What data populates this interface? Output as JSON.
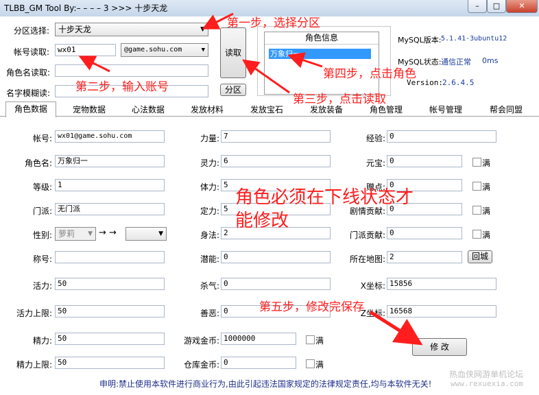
{
  "window": {
    "title": "TLBB_GM Tool By:– – – – 3 >>> 十步天龙",
    "controls": {
      "minimize": "–",
      "maximize": "□",
      "close": "✕"
    }
  },
  "top": {
    "region_label": "分区选择:",
    "region_value": "十步天龙",
    "account_label": "帐号读取:",
    "account_value": "wx01",
    "domain_value": "@game.sohu.com",
    "rolename_label": "角色名读取:",
    "fuzzy_label": "名字模糊读:",
    "read_button": "读取",
    "zone_button": "分区",
    "role_info_title": "角色信息",
    "role_list": [
      "万象归一"
    ],
    "mysql_version_label": "MySQL版本:",
    "mysql_version": "5.1.41-3ubuntu12",
    "mysql_status_label": "MySQL状态:",
    "mysql_status": "通信正常",
    "mysql_latency": "0ms",
    "version_label": "Version:",
    "version": "2.6.4.5"
  },
  "tabs": [
    "角色数据",
    "宠物数据",
    "心法数据",
    "发放材料",
    "发放宝石",
    "发放装备",
    "角色管理",
    "帐号管理",
    "帮会同盟"
  ],
  "fields": {
    "account_label": "帐号:",
    "account": "wx01@game.sohu.com",
    "rolename_label": "角色名:",
    "rolename": "万象归一",
    "level_label": "等级:",
    "level": "1",
    "sect_label": "门派:",
    "sect": "无门派",
    "gender_label": "性别:",
    "gender": "萝莉",
    "arrow_text": "→ →",
    "title_label": "称号:",
    "title": "",
    "vitality_label": "活力:",
    "vitality": "50",
    "vitality_max_label": "活力上限:",
    "vitality_max": "50",
    "energy_label": "精力:",
    "energy": "50",
    "energy_max_label": "精力上限:",
    "energy_max": "50",
    "strength_label": "力量:",
    "strength": "7",
    "spirit_label": "灵力:",
    "spirit": "6",
    "physique_label": "体力:",
    "physique": "5",
    "stamina_label": "定力:",
    "stamina": "5",
    "agility_label": "身法:",
    "agility": "2",
    "potential_label": "潜能:",
    "potential": "0",
    "killing_label": "杀气:",
    "killing": "0",
    "morality_label": "善恶:",
    "morality": "0",
    "game_gold_label": "游戏金币:",
    "game_gold": "1000000",
    "bank_gold_label": "仓库金币:",
    "bank_gold": "0",
    "exp_label": "经验:",
    "exp": "0",
    "yuanbao_label": "元宝:",
    "yuanbao": "0",
    "gift_label": "赠点:",
    "gift": "0",
    "plot_label": "剧情贡献:",
    "plot": "0",
    "sect_contrib_label": "门派贡献:",
    "sect_contrib": "0",
    "map_label": "所在地图:",
    "map": "2",
    "x_label": "X坐标:",
    "x": "15856",
    "z_label": "Z坐标:",
    "z": "16568",
    "full_label": "满",
    "return_button": "回城",
    "modify_button": "修  改"
  },
  "annotations": {
    "step1": "第一步，选择分区",
    "step2": "第二步，输入账号",
    "step3": "第三步，点击读取",
    "step4": "第四步，点击角色",
    "step5": "第五步，修改完保存",
    "notice": "角色必须在下线状态才能修改",
    "notice_line1": "角色必须在下线状态才",
    "notice_line2": "能修改"
  },
  "footer": {
    "disclaimer": "申明:禁止使用本软件进行商业行为,由此引起违法国家规定的法律规定责任,均与本软件无关!",
    "watermark_line1": "热血侠网游单机论坛",
    "watermark_line2": "www.rexuexia.com"
  },
  "colors": {
    "annotation": "#ff1d1d",
    "disclaimer": "#1f2e8a",
    "selection": "#3399ff",
    "link": "#1a3c9c"
  }
}
